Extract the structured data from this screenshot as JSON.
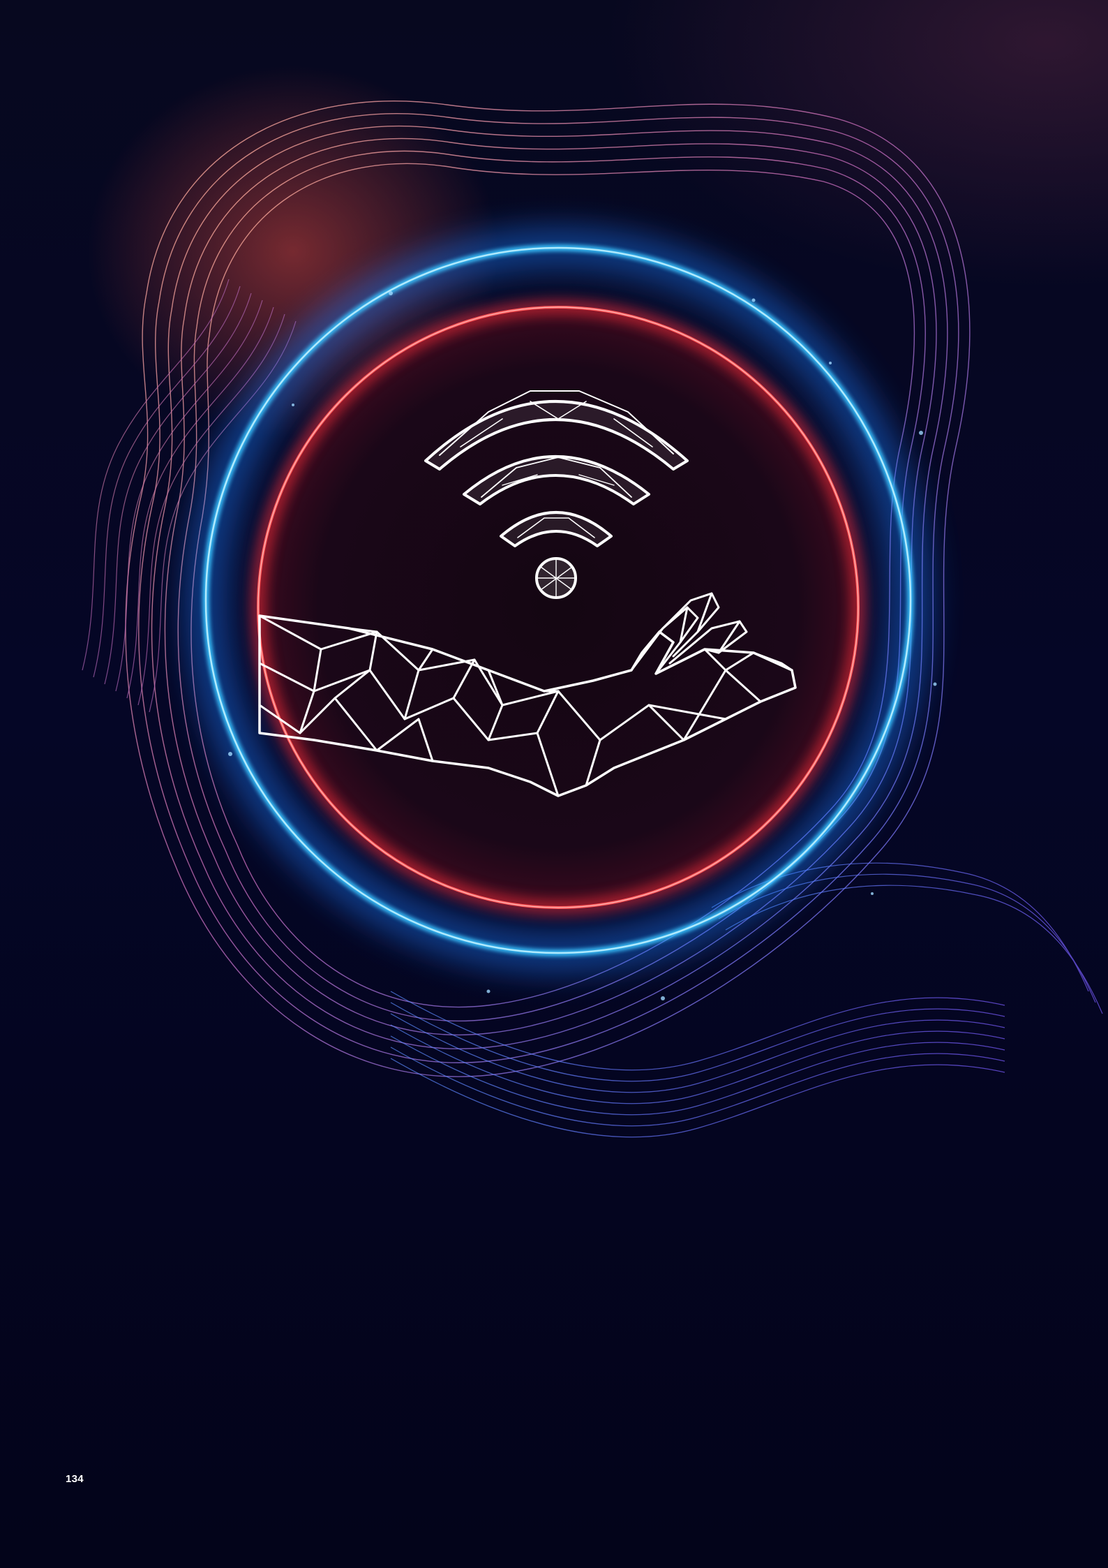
{
  "page": {
    "page_number": "134"
  },
  "illustration": {
    "icon": "wifi-signal-in-hand-icon",
    "colors": {
      "background": "#03041a",
      "outer_ring": "#2fb6ff",
      "inner_ring": "#ff3b3b",
      "wireframe": "#ffffff",
      "wave_lines_warm": "#ff9a7a",
      "wave_lines_cool": "#4f78ff"
    }
  }
}
